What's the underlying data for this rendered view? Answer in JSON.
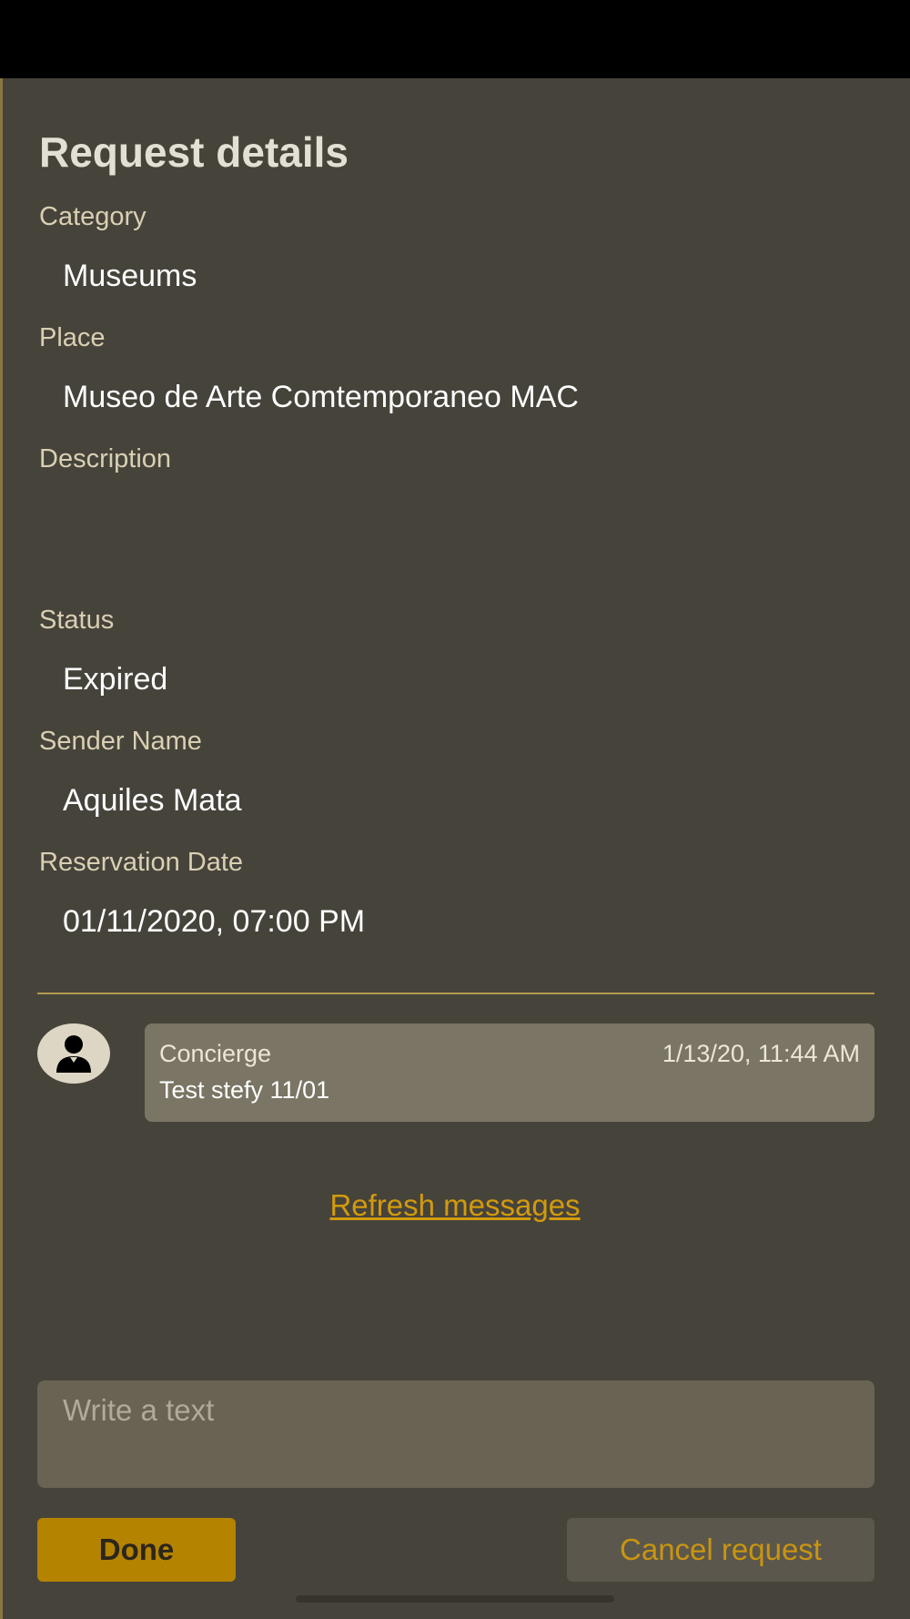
{
  "page": {
    "title": "Request details"
  },
  "fields": {
    "category": {
      "label": "Category",
      "value": "Museums"
    },
    "place": {
      "label": "Place",
      "value": "Museo de Arte Comtemporaneo MAC"
    },
    "description": {
      "label": "Description",
      "value": ""
    },
    "status": {
      "label": "Status",
      "value": "Expired"
    },
    "sender": {
      "label": "Sender Name",
      "value": "Aquiles Mata"
    },
    "reservation": {
      "label": "Reservation Date",
      "value": "01/11/2020, 07:00 PM"
    }
  },
  "messages": [
    {
      "author": "Concierge",
      "timestamp": "1/13/20, 11:44 AM",
      "text": "Test stefy 11/01",
      "avatar_icon": "user-icon"
    }
  ],
  "refresh_label": "Refresh messages",
  "composer": {
    "placeholder": "Write a text",
    "value": ""
  },
  "actions": {
    "done_label": "Done",
    "cancel_label": "Cancel request"
  },
  "colors": {
    "background": "#46433b",
    "accent": "#b48300",
    "divider": "#b3994d",
    "bubble": "#7a7564",
    "link": "#d29a0e"
  }
}
